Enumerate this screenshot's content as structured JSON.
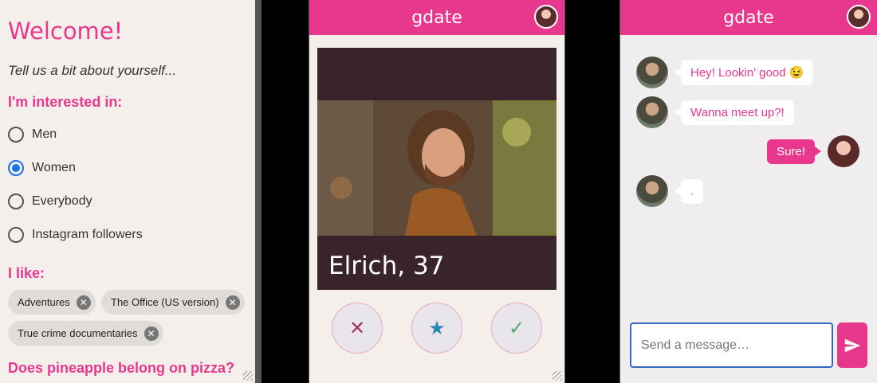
{
  "profile": {
    "welcome": "Welcome!",
    "intro": "Tell us a bit about yourself...",
    "interested_heading": "I'm interested in:",
    "options": [
      {
        "label": "Men",
        "checked": false
      },
      {
        "label": "Women",
        "checked": true
      },
      {
        "label": "Everybody",
        "checked": false
      },
      {
        "label": "Instagram followers",
        "checked": false
      }
    ],
    "like_heading": "I like:",
    "chips": [
      "Adventures",
      "The Office (US version)",
      "True crime documentaries"
    ],
    "pizza_question": "Does pineapple belong on pizza?"
  },
  "swipe": {
    "app_title": "gdate",
    "card_name": "Elrich, 37",
    "actions": {
      "reject": "✕",
      "star": "★",
      "accept": "✓"
    }
  },
  "chat": {
    "app_title": "gdate",
    "messages": [
      {
        "from": "them",
        "text": "Hey! Lookin' good 😉"
      },
      {
        "from": "them",
        "text": "Wanna meet up?!"
      },
      {
        "from": "me",
        "text": "Sure!"
      },
      {
        "from": "them",
        "text": "."
      }
    ],
    "input_placeholder": "Send a message…"
  },
  "colors": {
    "accent": "#e8388e",
    "radio_selected": "#1a73e8",
    "input_border": "#3b66c4"
  }
}
